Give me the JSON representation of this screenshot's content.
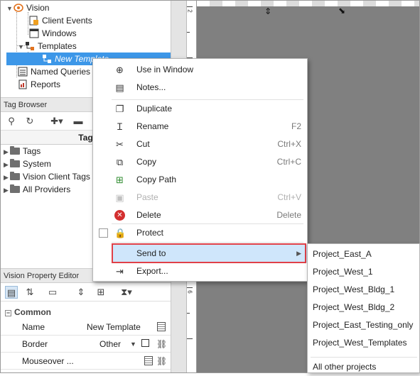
{
  "project_tree": {
    "items": [
      {
        "label": "Vision",
        "icon": "vision-eye-icon"
      },
      {
        "label": "Client Events",
        "icon": "client-events-icon"
      },
      {
        "label": "Windows",
        "icon": "windows-icon"
      },
      {
        "label": "Templates",
        "icon": "templates-icon"
      },
      {
        "label": "New Template",
        "icon": "template-icon",
        "selected": true
      },
      {
        "label": "Named Queries",
        "icon": "named-queries-icon"
      },
      {
        "label": "Reports",
        "icon": "reports-icon"
      }
    ]
  },
  "tag_browser": {
    "title": "Tag Browser",
    "column_header": "Tag",
    "items": [
      {
        "label": "Tags"
      },
      {
        "label": "System"
      },
      {
        "label": "Vision Client Tags"
      },
      {
        "label": "All Providers"
      }
    ]
  },
  "property_editor": {
    "title": "Vision Property Editor",
    "section": "Common",
    "rows": [
      {
        "name": "Name",
        "value": "New Template"
      },
      {
        "name": "Border",
        "value": "Other"
      },
      {
        "name": "Mouseover ...",
        "value": ""
      }
    ]
  },
  "context_menu": {
    "items": [
      {
        "label": "Use in Window",
        "shortcut": "",
        "icon": "crosshair-icon"
      },
      {
        "label": "Notes...",
        "shortcut": "",
        "icon": "notes-icon"
      },
      {
        "label": "Duplicate",
        "shortcut": "",
        "icon": "duplicate-icon"
      },
      {
        "label": "Rename",
        "shortcut": "F2",
        "icon": "rename-icon"
      },
      {
        "label": "Cut",
        "shortcut": "Ctrl+X",
        "icon": "scissors-icon"
      },
      {
        "label": "Copy",
        "shortcut": "Ctrl+C",
        "icon": "copy-icon"
      },
      {
        "label": "Copy Path",
        "shortcut": "",
        "icon": "copy-path-icon"
      },
      {
        "label": "Paste",
        "shortcut": "Ctrl+V",
        "icon": "paste-icon",
        "disabled": true
      },
      {
        "label": "Delete",
        "shortcut": "Delete",
        "icon": "delete-icon"
      },
      {
        "label": "Protect",
        "shortcut": "",
        "icon": "lock-icon"
      },
      {
        "label": "Send to",
        "shortcut": "",
        "icon": "",
        "highlighted": true
      },
      {
        "label": "Export...",
        "shortcut": "",
        "icon": "export-icon"
      }
    ]
  },
  "send_to_submenu": {
    "items": [
      "Project_East_A",
      "Project_West_1",
      "Project_West_Bldg_1",
      "Project_West_Bldg_2",
      "Project_East_Testing_only",
      "Project_West_Templates",
      "All other projects"
    ]
  },
  "colors": {
    "selection": "#3d97e8",
    "menu_highlight": "#cfe6fb",
    "highlight_border": "#e04048",
    "canvas": "#808080"
  }
}
